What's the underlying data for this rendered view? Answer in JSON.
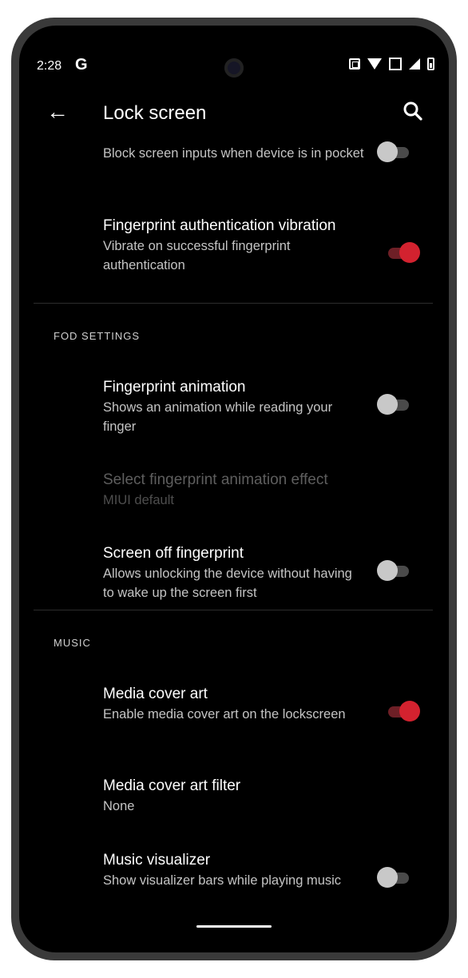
{
  "status": {
    "time": "2:28",
    "g_icon": "G",
    "icons": [
      "sim-icon",
      "wifi-icon",
      "volte-icon",
      "signal-icon",
      "battery-icon"
    ]
  },
  "appbar": {
    "title": "Lock screen",
    "back_icon": "arrow-back-icon",
    "search_icon": "search-icon"
  },
  "items": [
    {
      "title": "",
      "summary": "Block screen inputs when device is in pocket",
      "toggle": false
    },
    {
      "title": "Fingerprint authentication vibration",
      "summary": "Vibrate on successful fingerprint authentication",
      "toggle": true
    },
    {
      "title": "Fingerprint animation",
      "summary": "Shows an animation while reading your finger",
      "toggle": false
    },
    {
      "title": "Select fingerprint animation effect",
      "summary": "MIUI default",
      "disabled": true
    },
    {
      "title": "Screen off fingerprint",
      "summary": "Allows unlocking the device without having to wake up the screen first",
      "toggle": false
    },
    {
      "title": "Media cover art",
      "summary": "Enable media cover art on the lockscreen",
      "toggle": true
    },
    {
      "title": "Media cover art filter",
      "summary": "None"
    },
    {
      "title": "Music visualizer",
      "summary": "Show visualizer bars while playing music",
      "toggle": false
    }
  ],
  "sections": {
    "fod": "FOD SETTINGS",
    "music": "MUSIC"
  },
  "colors": {
    "accent": "#d3222f",
    "background": "#000000",
    "frame": "#3a3a3a"
  }
}
